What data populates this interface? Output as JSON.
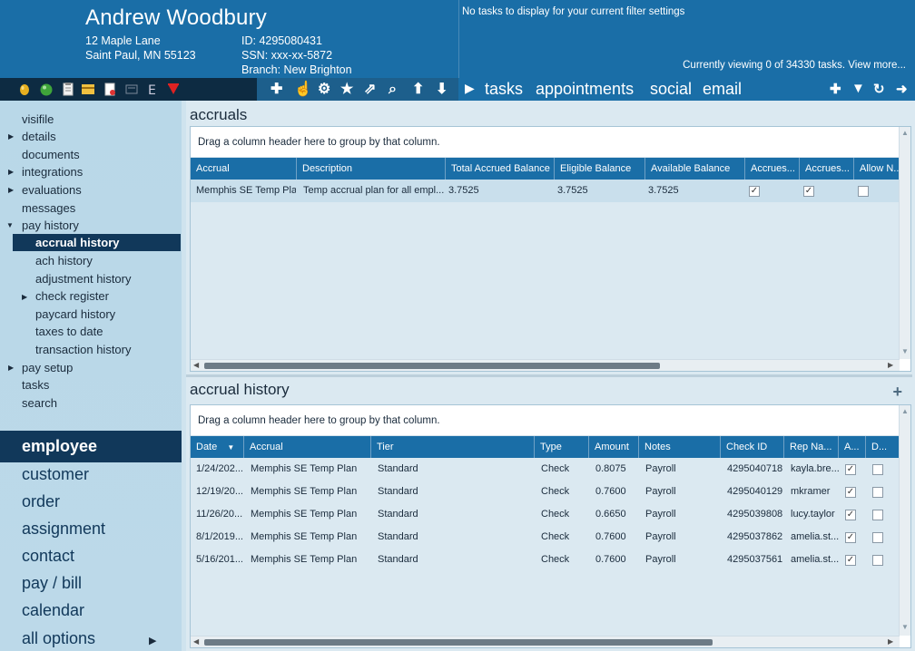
{
  "header": {
    "name": "Andrew Woodbury",
    "address_line1": "12 Maple Lane",
    "address_line2": "Saint Paul, MN 55123",
    "id_line": "ID: 4295080431",
    "ssn_line": "SSN: xxx-xx-5872",
    "branch_line": "Branch:  New Brighton",
    "tasks_message": "No tasks to display for your current filter settings",
    "viewing_message": "Currently viewing 0 of 34330 tasks. View more..."
  },
  "right_toolbar": {
    "tabs": [
      "tasks",
      "appointments",
      "social",
      "email"
    ]
  },
  "sidebar": {
    "items": [
      {
        "label": "visifile",
        "arrow": ""
      },
      {
        "label": "details",
        "arrow": "right"
      },
      {
        "label": "documents",
        "arrow": ""
      },
      {
        "label": "integrations",
        "arrow": "right"
      },
      {
        "label": "evaluations",
        "arrow": "right"
      },
      {
        "label": "messages",
        "arrow": ""
      },
      {
        "label": "pay history",
        "arrow": "down"
      }
    ],
    "sub_items": [
      {
        "label": "accrual history",
        "active": true
      },
      {
        "label": "ach history"
      },
      {
        "label": "adjustment history"
      },
      {
        "label": "check register",
        "arrow": "right"
      },
      {
        "label": "paycard history"
      },
      {
        "label": "taxes to date"
      },
      {
        "label": "transaction history"
      }
    ],
    "items_after": [
      {
        "label": "pay setup",
        "arrow": "right"
      },
      {
        "label": "tasks",
        "arrow": ""
      },
      {
        "label": "search",
        "arrow": ""
      }
    ],
    "big_items": [
      "employee",
      "customer",
      "order",
      "assignment",
      "contact",
      "pay / bill",
      "calendar",
      "all options"
    ]
  },
  "accruals": {
    "title": "accruals",
    "group_hint": "Drag a column header here to group by that column.",
    "columns": [
      "Accrual",
      "Description",
      "Total Accrued Balance",
      "Eligible Balance",
      "Available Balance",
      "Accrues...",
      "Accrues...",
      "Allow N..."
    ],
    "rows": [
      {
        "accrual": "Memphis SE Temp Plan",
        "description": "Temp accrual plan for all empl...",
        "total": "3.7525",
        "eligible": "3.7525",
        "available": "3.7525",
        "c1": true,
        "c2": true,
        "c3": false
      }
    ]
  },
  "accrual_history": {
    "title": "accrual history",
    "group_hint": "Drag a column header here to group by that column.",
    "columns": [
      "Date",
      "Accrual",
      "Tier",
      "Type",
      "Amount",
      "Notes",
      "Check ID",
      "Rep Na...",
      "A...",
      "D..."
    ],
    "rows": [
      {
        "date": "1/24/202...",
        "accrual": "Memphis SE Temp Plan",
        "tier": "Standard",
        "type": "Check",
        "amount": "0.8075",
        "notes": "Payroll",
        "check_id": "4295040718",
        "rep": "kayla.bre...",
        "a": true,
        "d": false
      },
      {
        "date": "12/19/20...",
        "accrual": "Memphis SE Temp Plan",
        "tier": "Standard",
        "type": "Check",
        "amount": "0.7600",
        "notes": "Payroll",
        "check_id": "4295040129",
        "rep": "mkramer",
        "a": true,
        "d": false
      },
      {
        "date": "11/26/20...",
        "accrual": "Memphis SE Temp Plan",
        "tier": "Standard",
        "type": "Check",
        "amount": "0.6650",
        "notes": "Payroll",
        "check_id": "4295039808",
        "rep": "lucy.taylor",
        "a": true,
        "d": false
      },
      {
        "date": "8/1/2019...",
        "accrual": "Memphis SE Temp Plan",
        "tier": "Standard",
        "type": "Check",
        "amount": "0.7600",
        "notes": "Payroll",
        "check_id": "4295037862",
        "rep": "amelia.st...",
        "a": true,
        "d": false
      },
      {
        "date": "5/16/201...",
        "accrual": "Memphis SE Temp Plan",
        "tier": "Standard",
        "type": "Check",
        "amount": "0.7600",
        "notes": "Payroll",
        "check_id": "4295037561",
        "rep": "amelia.st...",
        "a": true,
        "d": false
      }
    ]
  }
}
